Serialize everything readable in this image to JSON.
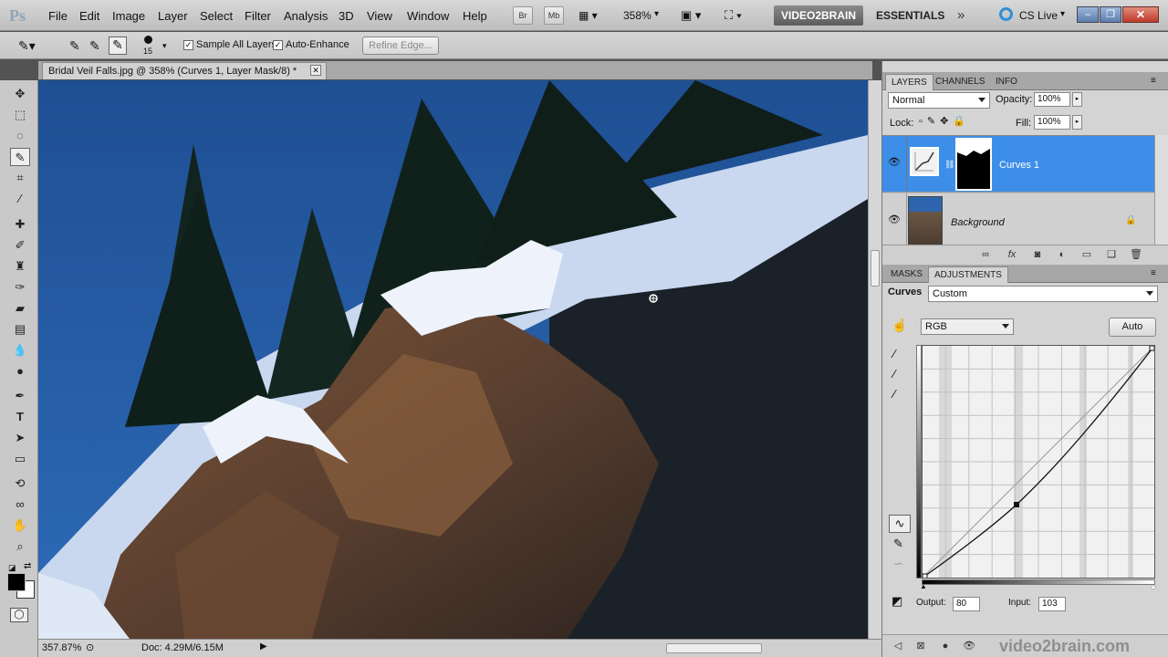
{
  "app": {
    "logo": "Ps"
  },
  "menu": [
    "File",
    "Edit",
    "Image",
    "Layer",
    "Select",
    "Filter",
    "Analysis",
    "3D",
    "View",
    "Window",
    "Help"
  ],
  "menubar_extras": {
    "br": "Br",
    "mb": "Mb",
    "zoom": "358%",
    "workspace1": "VIDEO2BRAIN",
    "workspace2": "ESSENTIALS",
    "cslive": "CS Live"
  },
  "options": {
    "brush_size": "15",
    "sample_all_layers": "Sample All Layers",
    "auto_enhance": "Auto-Enhance",
    "refine_edge": "Refine Edge..."
  },
  "document": {
    "tab_title": "Bridal Veil Falls.jpg @ 358% (Curves 1, Layer Mask/8) *"
  },
  "status": {
    "zoom": "357.87%",
    "doc": "Doc: 4.29M/6.15M"
  },
  "layers_panel": {
    "tabs": [
      "LAYERS",
      "CHANNELS",
      "INFO"
    ],
    "blend_mode": "Normal",
    "opacity_label": "Opacity:",
    "opacity": "100%",
    "lock_label": "Lock:",
    "fill_label": "Fill:",
    "fill": "100%",
    "layers": [
      {
        "name": "Curves 1",
        "selected": true
      },
      {
        "name": "Background",
        "selected": false
      }
    ]
  },
  "adjust_panel": {
    "tabs": [
      "MASKS",
      "ADJUSTMENTS"
    ],
    "title": "Curves",
    "preset": "Custom",
    "channel": "RGB",
    "auto": "Auto",
    "output_label": "Output:",
    "output": "80",
    "input_label": "Input:",
    "input": "103"
  },
  "watermark": "video2brain.com",
  "colors": {
    "selected": "#3d8ee8",
    "panel": "#d4d4d4"
  }
}
